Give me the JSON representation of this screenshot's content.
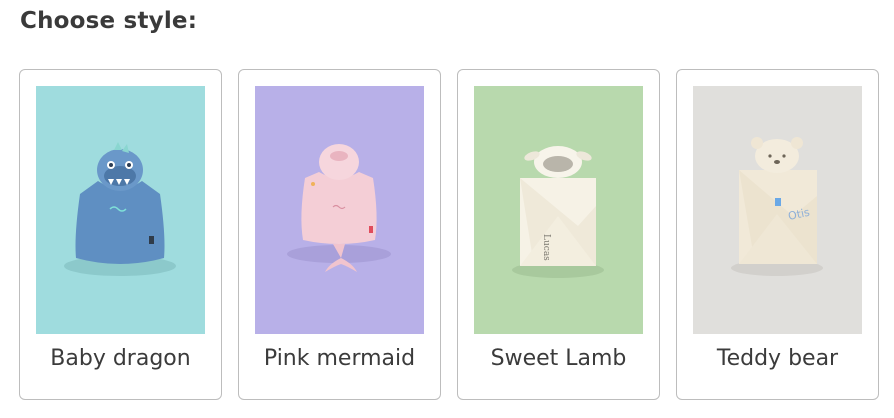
{
  "heading": "Choose style:",
  "styles": [
    {
      "label": "Baby dragon",
      "bg": "#9fdcde",
      "towel": "#5f8fc2"
    },
    {
      "label": "Pink mermaid",
      "bg": "#b8b0e8",
      "towel": "#f4ced6"
    },
    {
      "label": "Sweet Lamb",
      "bg": "#b8d9ad",
      "towel": "#f6f2e6",
      "embroidery": "Lucas"
    },
    {
      "label": "Teddy bear",
      "bg": "#e0dfdc",
      "towel": "#f1e9d8",
      "embroidery": "Otis"
    }
  ]
}
